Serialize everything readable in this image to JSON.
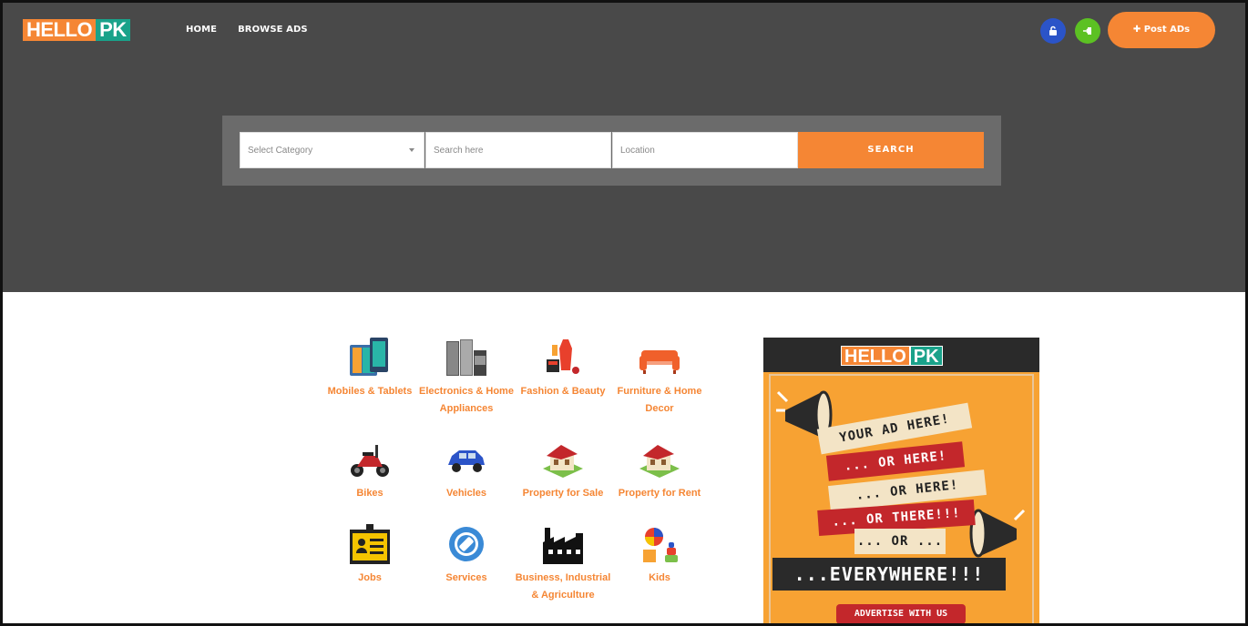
{
  "header": {
    "logo_part1": "HELLO",
    "logo_part2": "PK",
    "nav": [
      "HOME",
      "BROWSE ADS"
    ],
    "unlock_icon": "unlock-icon",
    "login_icon": "sign-in-icon",
    "post_button": "✚ Post ADs"
  },
  "search": {
    "category_placeholder": "Select Category",
    "query_placeholder": "Search here",
    "location_placeholder": "Location",
    "button": "SEARCH"
  },
  "categories": [
    {
      "label": "Mobiles & Tablets",
      "icon": "tablet-icon"
    },
    {
      "label": "Electronics & Home Appliances",
      "icon": "appliances-icon"
    },
    {
      "label": "Fashion & Beauty",
      "icon": "fashion-icon"
    },
    {
      "label": "Furniture & Home Decor",
      "icon": "sofa-icon"
    },
    {
      "label": "Bikes",
      "icon": "scooter-icon"
    },
    {
      "label": "Vehicles",
      "icon": "car-icon"
    },
    {
      "label": "Property for Sale",
      "icon": "house-icon"
    },
    {
      "label": "Property for Rent",
      "icon": "house-icon"
    },
    {
      "label": "Jobs",
      "icon": "id-badge-icon"
    },
    {
      "label": "Services",
      "icon": "gear-wrench-icon"
    },
    {
      "label": "Business, Industrial & Agriculture",
      "icon": "factory-icon"
    },
    {
      "label": "Kids",
      "icon": "toys-icon"
    }
  ],
  "ad": {
    "logo_part1": "HELLO",
    "logo_part2": "PK",
    "signs": [
      "YOUR AD HERE!",
      "... OR HERE!",
      "... OR HERE!",
      "... OR THERE!!!",
      "... OR ...",
      "...EVERYWHERE!!!"
    ],
    "footer": "ADVERTISE WITH US"
  },
  "colors": {
    "accent": "#f58634",
    "header_bg": "#494949",
    "logo_green": "#1aa28a"
  }
}
